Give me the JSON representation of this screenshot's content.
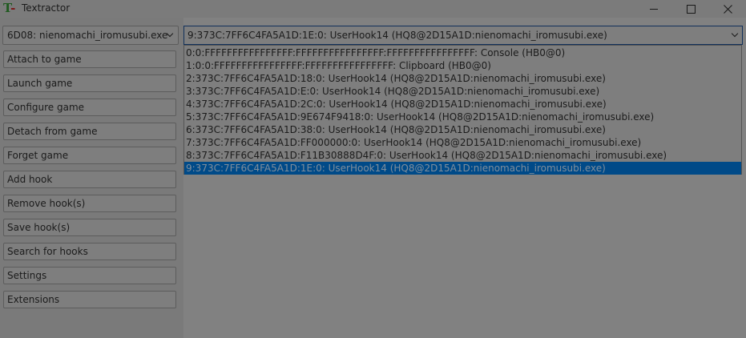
{
  "window": {
    "title": "Textractor",
    "logo_letter": "T",
    "logo_mark": "-"
  },
  "sidebar": {
    "process_select_value": "6D08: nienomachi_iromusubi.exe",
    "buttons": [
      "Attach to game",
      "Launch game",
      "Configure game",
      "Detach from game",
      "Forget game",
      "Add hook",
      "Remove hook(s)",
      "Save hook(s)",
      "Search for hooks",
      "Settings",
      "Extensions"
    ]
  },
  "main": {
    "hook_select_value": "9:373C:7FF6C4FA5A1D:1E:0: UserHook14 (HQ8@2D15A1D:nienomachi_iromusubi.exe)",
    "hook_options": [
      "0:0:FFFFFFFFFFFFFFFF:FFFFFFFFFFFFFFFF:FFFFFFFFFFFFFFFF: Console (HB0@0)",
      "1:0:0:FFFFFFFFFFFFFFFF:FFFFFFFFFFFFFFFF: Clipboard (HB0@0)",
      "2:373C:7FF6C4FA5A1D:18:0: UserHook14 (HQ8@2D15A1D:nienomachi_iromusubi.exe)",
      "3:373C:7FF6C4FA5A1D:E:0: UserHook14 (HQ8@2D15A1D:nienomachi_iromusubi.exe)",
      "4:373C:7FF6C4FA5A1D:2C:0: UserHook14 (HQ8@2D15A1D:nienomachi_iromusubi.exe)",
      "5:373C:7FF6C4FA5A1D:9E674F9418:0: UserHook14 (HQ8@2D15A1D:nienomachi_iromusubi.exe)",
      "6:373C:7FF6C4FA5A1D:38:0: UserHook14 (HQ8@2D15A1D:nienomachi_iromusubi.exe)",
      "7:373C:7FF6C4FA5A1D:FF000000:0: UserHook14 (HQ8@2D15A1D:nienomachi_iromusubi.exe)",
      "8:373C:7FF6C4FA5A1D:F11B30888D4F:0: UserHook14 (HQ8@2D15A1D:nienomachi_iromusubi.exe)",
      "9:373C:7FF6C4FA5A1D:1E:0: UserHook14 (HQ8@2D15A1D:nienomachi_iromusubi.exe)"
    ],
    "selected_index": 9
  },
  "colors": {
    "selection": "#004a88",
    "focus_border": "#11305a"
  }
}
